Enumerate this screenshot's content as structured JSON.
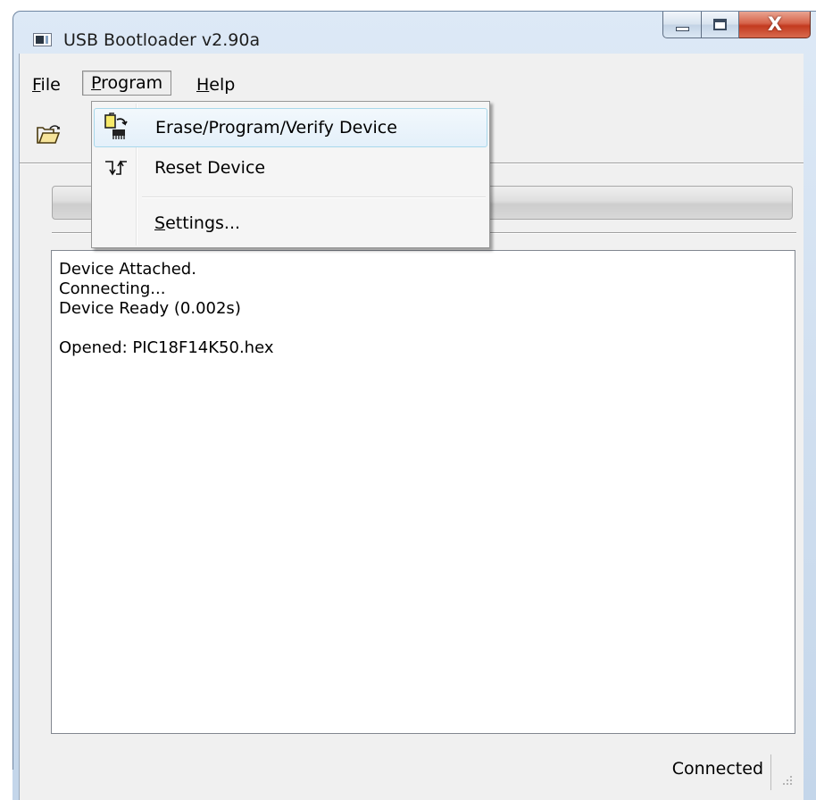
{
  "window": {
    "title": "USB Bootloader v2.90a",
    "close_glyph": "X"
  },
  "menubar": {
    "file": {
      "underline": "F",
      "rest": "ile"
    },
    "program": {
      "underline": "P",
      "rest": "rogram"
    },
    "help": {
      "underline": "H",
      "rest": "elp"
    }
  },
  "program_menu": {
    "items": [
      {
        "label": "Erase/Program/Verify Device",
        "icon": "erase-program-verify-icon"
      },
      {
        "label": "Reset Device",
        "icon": "reset-device-icon"
      },
      {
        "label_underline": "S",
        "label_rest": "ettings..."
      }
    ]
  },
  "toolbar": {
    "open_icon": "open-folder-icon"
  },
  "progress": {
    "value": 0
  },
  "log": {
    "lines": [
      "Device Attached.",
      "Connecting...",
      "Device Ready (0.002s)",
      "",
      "Opened: PIC18F14K50.hex"
    ]
  },
  "statusbar": {
    "text": "Connected"
  },
  "colors": {
    "frame": "#cfdeef",
    "client": "#f0f0f0",
    "menu_hover_border": "#a8d8eb",
    "close_button": "#c33a1f"
  }
}
